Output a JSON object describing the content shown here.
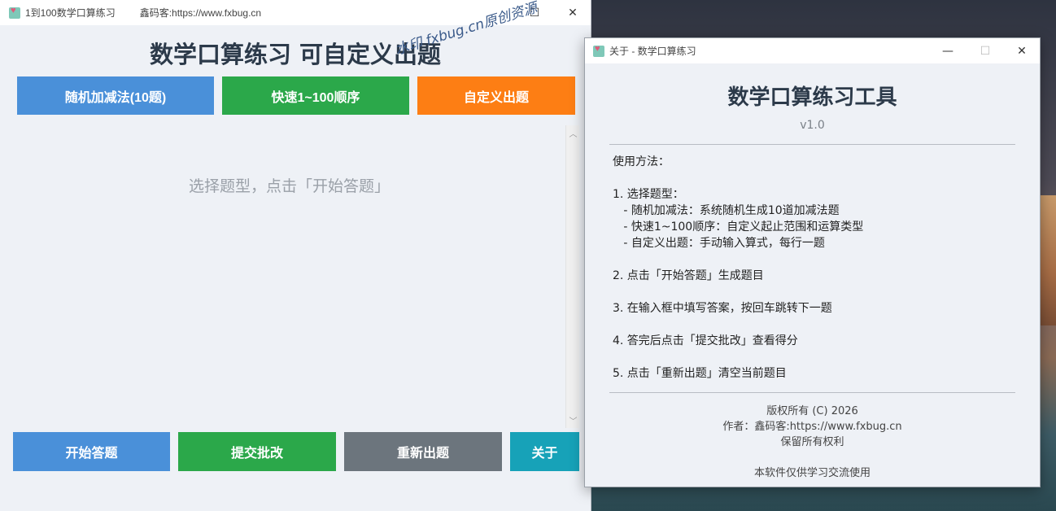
{
  "main_window": {
    "title": "1到100数学口算练习",
    "subtitle": "鑫码客:https://www.fxbug.cn",
    "heading": "数学口算练习 可自定义出题",
    "mode_buttons": [
      "随机加减法(10题)",
      "快速1~100顺序",
      "自定义出题"
    ],
    "placeholder": "选择题型，点击「开始答题」",
    "action_buttons": [
      "开始答题",
      "提交批改",
      "重新出题",
      "关于"
    ],
    "watermark": "水印 fxbug.cn原创资源"
  },
  "about_dialog": {
    "title": "关于 - 数学口算练习",
    "heading": "数学口算练习工具",
    "version": "v1.0",
    "instructions": [
      "使用方法：",
      "",
      "1. 选择题型：",
      "   - 随机加减法：系统随机生成10道加减法题",
      "   - 快速1~100顺序：自定义起止范围和运算类型",
      "   - 自定义出题：手动输入算式，每行一题",
      "",
      "2. 点击「开始答题」生成题目",
      "",
      "3. 在输入框中填写答案，按回车跳转下一题",
      "",
      "4. 答完后点击「提交批改」查看得分",
      "",
      "5. 点击「重新出题」清空当前题目"
    ],
    "copyright": "版权所有 (C) 2026",
    "author": "作者：鑫码客:https://www.fxbug.cn",
    "rights": "保留所有权利",
    "notice": "本软件仅供学习交流使用"
  },
  "icons": {
    "app": "heart-app-icon",
    "minimize": "minimize-icon",
    "maximize": "maximize-icon",
    "close": "close-icon"
  }
}
